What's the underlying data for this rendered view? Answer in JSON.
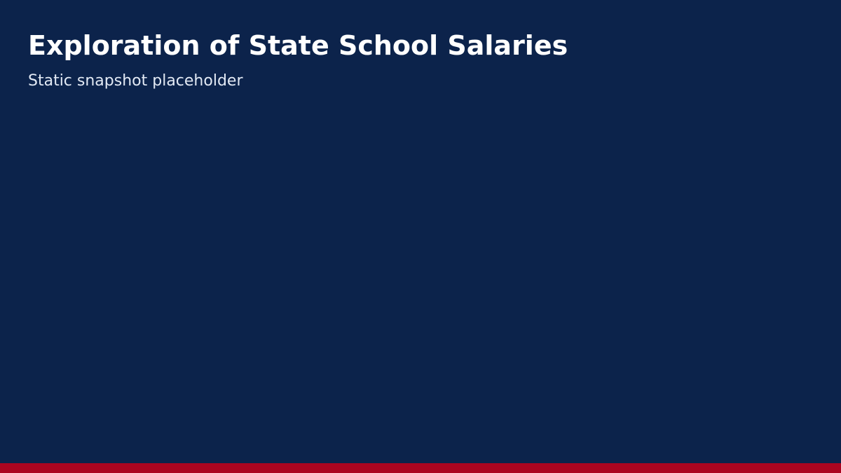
{
  "page": {
    "title": "Exploration of State School Salaries",
    "subtitle": "Static snapshot placeholder"
  },
  "colors": {
    "background": "#0c234b",
    "title": "#ffffff",
    "subtitle": "#e2e9f4",
    "accent_bar": "#ab0520"
  }
}
